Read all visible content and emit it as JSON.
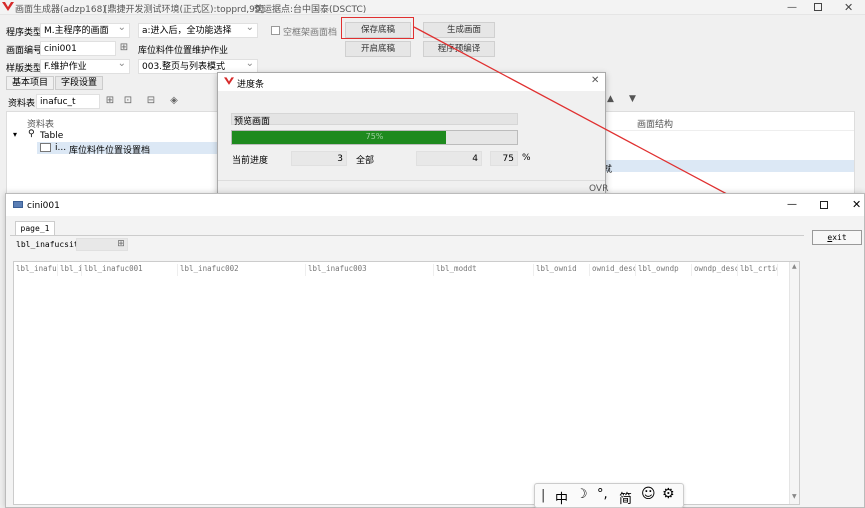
{
  "app": {
    "title": "画面生成器(adzp168)",
    "env": "[鼎捷开发测试环境(正式区):topprd,99]",
    "site": "营运据点:台中国泰(DSCTC)"
  },
  "form": {
    "program_type_label": "程序类型",
    "program_type_value": "M.主程序的画面",
    "entry_mode_value": "a:进入后，全功能选择",
    "empty_frame_label": "空框架画面档",
    "save_draft": "保存底稿",
    "generate_screen": "生成画面",
    "screen_no_label": "画面编号",
    "screen_no_value": "cini001",
    "screen_desc": "库位料件位置维护作业",
    "open_draft": "开启底稿",
    "precompile": "程序预编译",
    "style_type_label": "样版类型",
    "style_type_value": "F.维护作业",
    "layout_value": "003.整页与列表模式"
  },
  "tabs": {
    "basic": "基本项目",
    "field_settings": "字段设置"
  },
  "table_area": {
    "label": "资料表",
    "value": "inafuc_t",
    "col_header": "资料表",
    "tree_root": "Table",
    "tree_child_short": "i...",
    "tree_child_desc": "库位料件位置设置档",
    "right_header": "画面结构",
    "right_row": "就"
  },
  "progress": {
    "title": "进度条",
    "task": "预览画面",
    "percent_text": "75%",
    "fraction": 0.75,
    "current_label": "当前进度",
    "current": "3",
    "total_label": "全部",
    "total": "4",
    "pct": "75",
    "pct_sign": "%",
    "status": "OVR"
  },
  "preview": {
    "title": "cini001",
    "tab": "page_1",
    "field_label": "lbl_inafucsite",
    "columns": [
      "lbl_inafu",
      "lbl_i",
      "lbl_inafuc001",
      "lbl_inafuc002",
      "lbl_inafuc003",
      "lbl_moddt",
      "lbl_ownid",
      "ownid_desc",
      "lbl_owndp",
      "owndp_desc",
      "lbl_crtid"
    ],
    "exit": "exit",
    "exit_accel": "e",
    "exit_rest": "xit"
  },
  "ime": {
    "cursor": "|",
    "lang": "中",
    "moon": "☽",
    "punct": "°,",
    "simp": "简",
    "smile": "☺",
    "gear": "⚙"
  },
  "colors": {
    "progress_fill": "#1e8a1e",
    "annotation": "#e03030",
    "title_bar": "#ffffff"
  }
}
